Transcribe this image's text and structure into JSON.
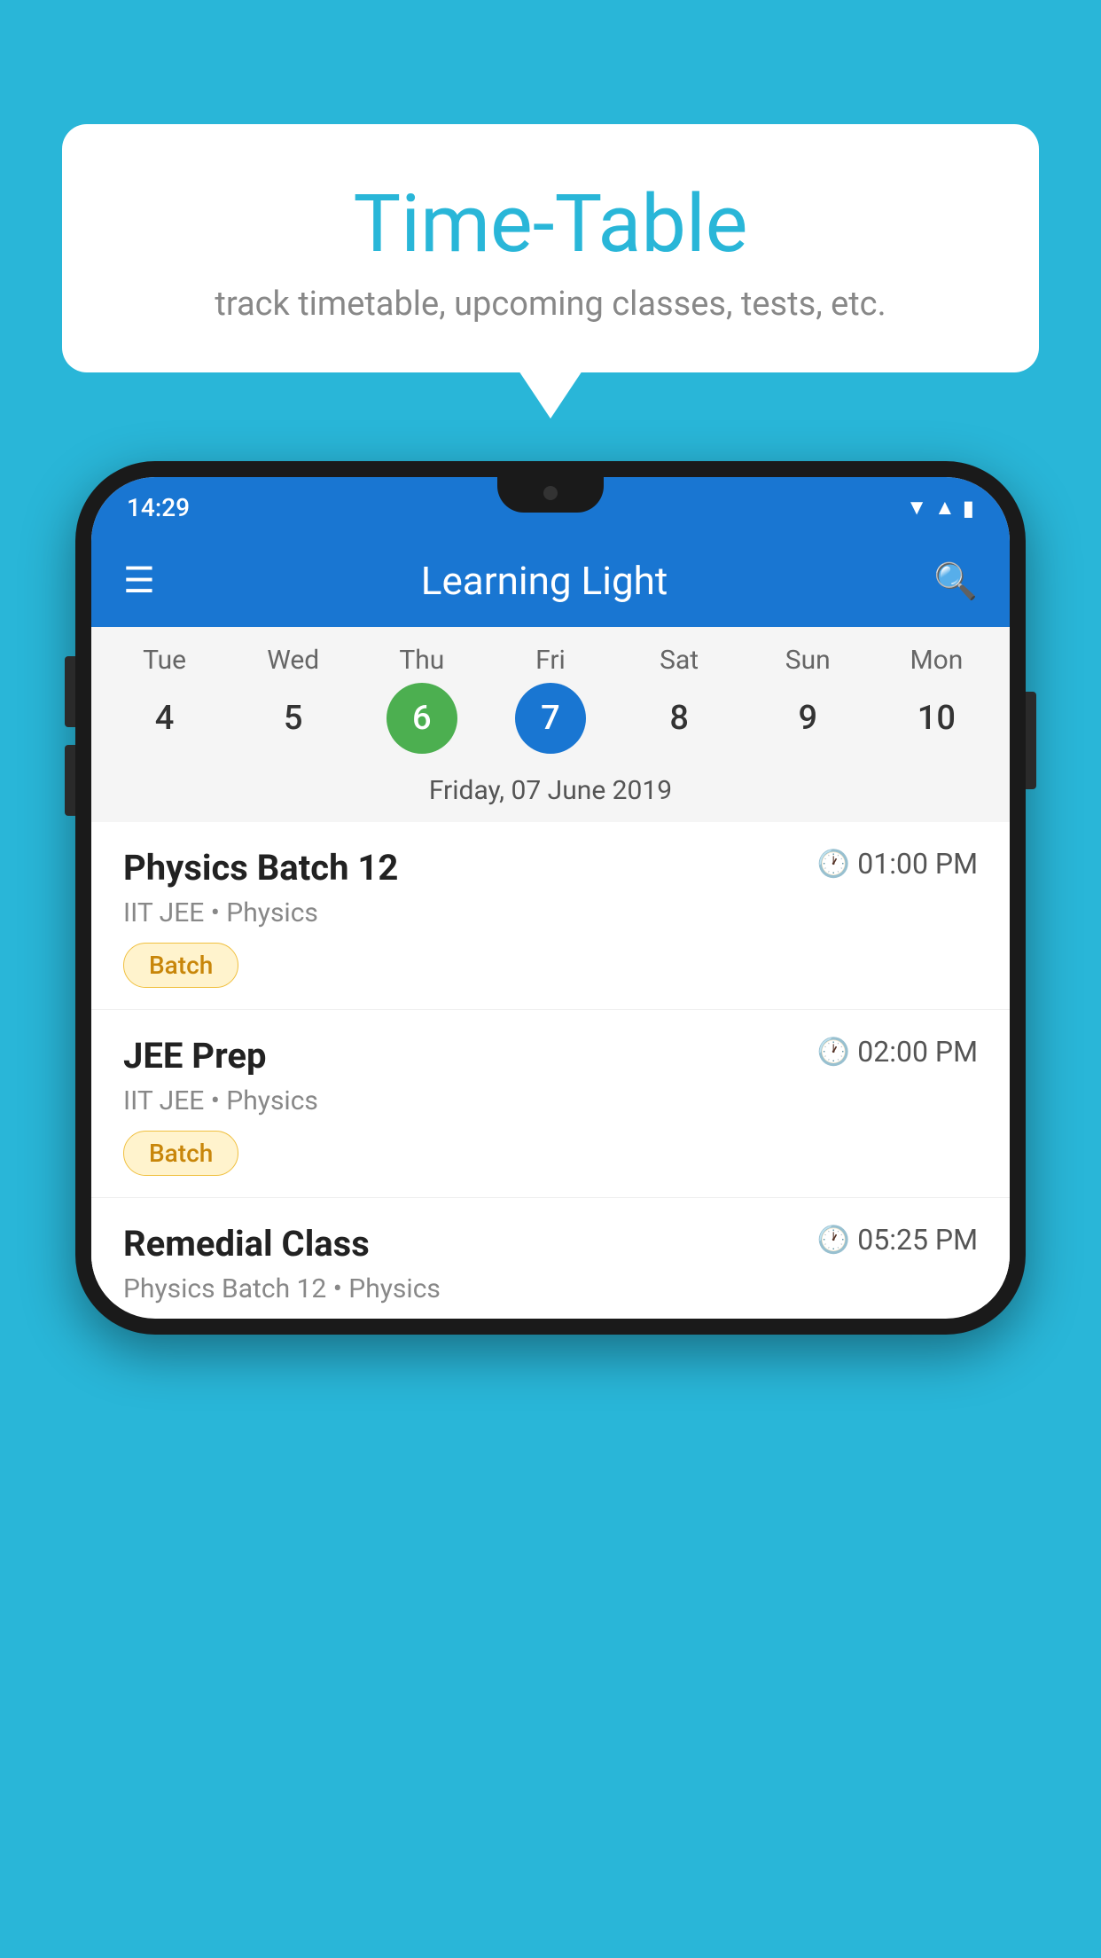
{
  "page": {
    "background_color": "#29B6D8"
  },
  "speech_bubble": {
    "title": "Time-Table",
    "subtitle": "track timetable, upcoming classes, tests, etc."
  },
  "phone": {
    "status_bar": {
      "time": "14:29"
    },
    "app_bar": {
      "title": "Learning Light"
    },
    "calendar": {
      "days": [
        {
          "name": "Tue",
          "number": "4",
          "state": "normal"
        },
        {
          "name": "Wed",
          "number": "5",
          "state": "normal"
        },
        {
          "name": "Thu",
          "number": "6",
          "state": "today"
        },
        {
          "name": "Fri",
          "number": "7",
          "state": "selected"
        },
        {
          "name": "Sat",
          "number": "8",
          "state": "normal"
        },
        {
          "name": "Sun",
          "number": "9",
          "state": "normal"
        },
        {
          "name": "Mon",
          "number": "10",
          "state": "normal"
        }
      ],
      "selected_date": "Friday, 07 June 2019"
    },
    "schedule_items": [
      {
        "title": "Physics Batch 12",
        "time": "01:00 PM",
        "subtitle": "IIT JEE • Physics",
        "badge": "Batch"
      },
      {
        "title": "JEE Prep",
        "time": "02:00 PM",
        "subtitle": "IIT JEE • Physics",
        "badge": "Batch"
      },
      {
        "title": "Remedial Class",
        "time": "05:25 PM",
        "subtitle": "Physics Batch 12 • Physics",
        "badge": ""
      }
    ]
  }
}
